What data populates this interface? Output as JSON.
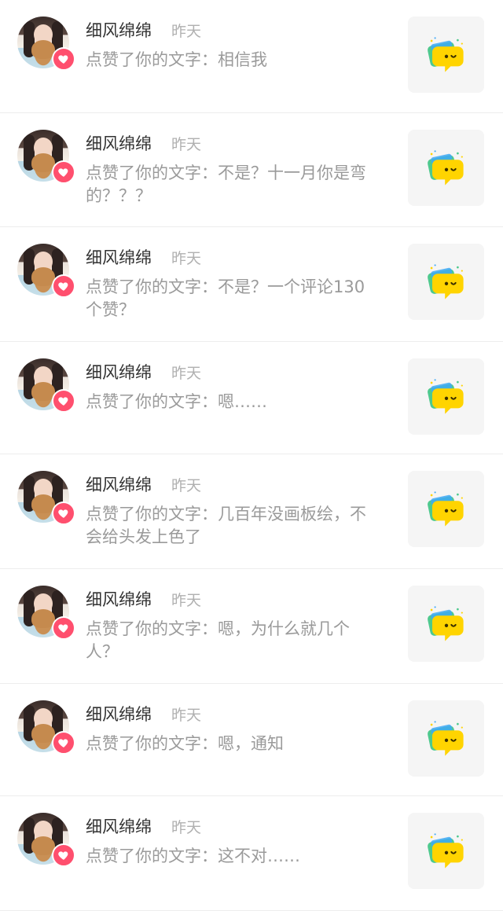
{
  "notifications": [
    {
      "user": "细风绵绵",
      "time": "昨天",
      "text": "点赞了你的文字：相信我",
      "thumb_icon": "speech-bubble-smiley-icon"
    },
    {
      "user": "细风绵绵",
      "time": "昨天",
      "text": "点赞了你的文字：不是？十一月你是弯的？？？",
      "thumb_icon": "speech-bubble-smiley-icon"
    },
    {
      "user": "细风绵绵",
      "time": "昨天",
      "text": "点赞了你的文字：不是？一个评论130个赞？",
      "thumb_icon": "speech-bubble-smiley-icon"
    },
    {
      "user": "细风绵绵",
      "time": "昨天",
      "text": "点赞了你的文字：嗯……",
      "thumb_icon": "speech-bubble-smiley-icon"
    },
    {
      "user": "细风绵绵",
      "time": "昨天",
      "text": "点赞了你的文字：几百年没画板绘，不会给头发上色了",
      "thumb_icon": "speech-bubble-smiley-icon"
    },
    {
      "user": "细风绵绵",
      "time": "昨天",
      "text": "点赞了你的文字：嗯，为什么就几个人？",
      "thumb_icon": "speech-bubble-smiley-icon"
    },
    {
      "user": "细风绵绵",
      "time": "昨天",
      "text": "点赞了你的文字：嗯，通知",
      "thumb_icon": "speech-bubble-smiley-icon"
    },
    {
      "user": "细风绵绵",
      "time": "昨天",
      "text": "点赞了你的文字：这不对……",
      "thumb_icon": "speech-bubble-smiley-icon"
    }
  ],
  "colors": {
    "heart_badge": "#ff4f6e",
    "name": "#333333",
    "secondary_text": "#9a9a9a",
    "bubble_yellow": "#ffd400",
    "bubble_green": "#4ec98e",
    "bubble_blue": "#3fa9f5"
  }
}
